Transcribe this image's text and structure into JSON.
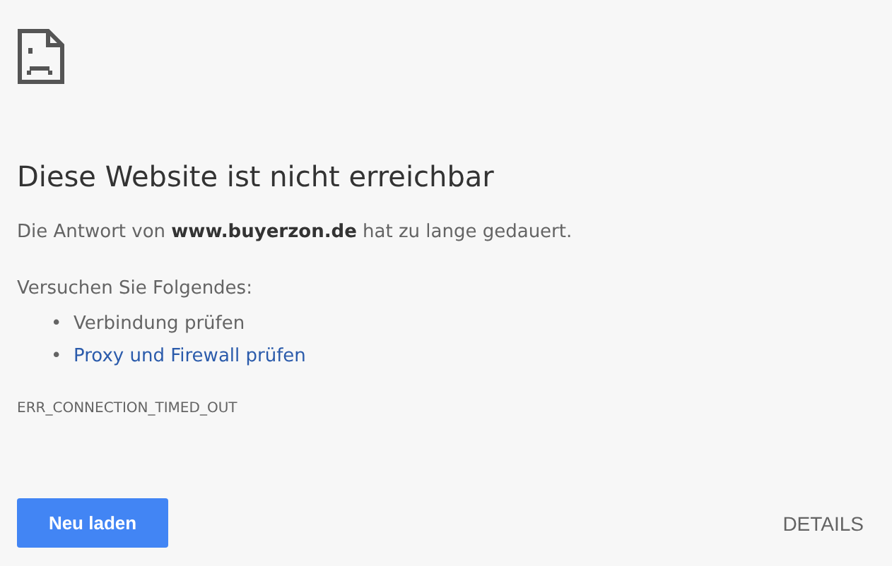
{
  "heading": "Diese Website ist nicht erreichbar",
  "message": "Die Antwort von **www.buyerzon.de** hat zu lange gedauert.",
  "suggestions_intro": "Versuchen Sie Folgendes:",
  "suggestions": [
    {
      "kind": "text",
      "bullet": "•",
      "label": "Verbindung prüfen"
    },
    {
      "kind": "link",
      "bullet": "•",
      "label": "Proxy und Firewall prüfen"
    }
  ],
  "error_code": "ERR_CONNECTION_TIMED_OUT",
  "reload_button": "Neu laden",
  "details_button": "DETAILS"
}
